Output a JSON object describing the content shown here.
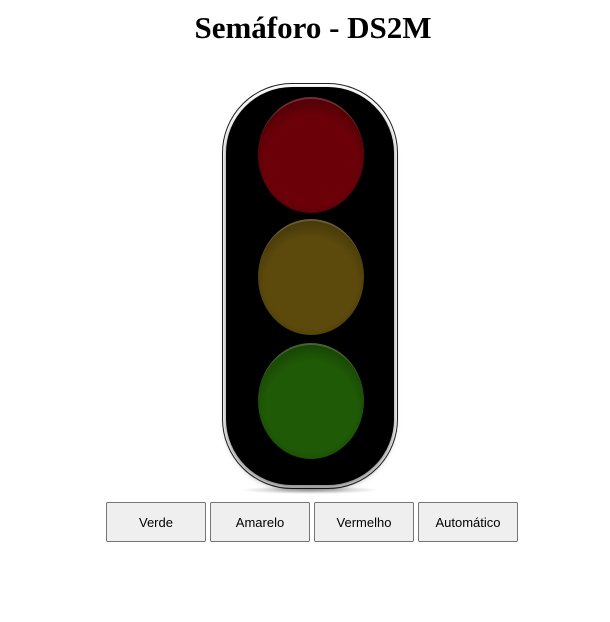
{
  "page": {
    "title": "Semáforo - DS2M"
  },
  "traffic_light": {
    "lamps": [
      {
        "name": "red",
        "state": "off",
        "color_off": "#6b0008",
        "color_on": "#ff1a1a"
      },
      {
        "name": "yellow",
        "state": "off",
        "color_off": "#5c4a0c",
        "color_on": "#ffcc00"
      },
      {
        "name": "green",
        "state": "off",
        "color_off": "#1f5a06",
        "color_on": "#33ff33"
      }
    ],
    "housing_color": "#000000"
  },
  "controls": {
    "buttons": [
      {
        "id": "verde",
        "label": "Verde"
      },
      {
        "id": "amarelo",
        "label": "Amarelo"
      },
      {
        "id": "vermelho",
        "label": "Vermelho"
      },
      {
        "id": "automatico",
        "label": "Automático"
      }
    ]
  }
}
